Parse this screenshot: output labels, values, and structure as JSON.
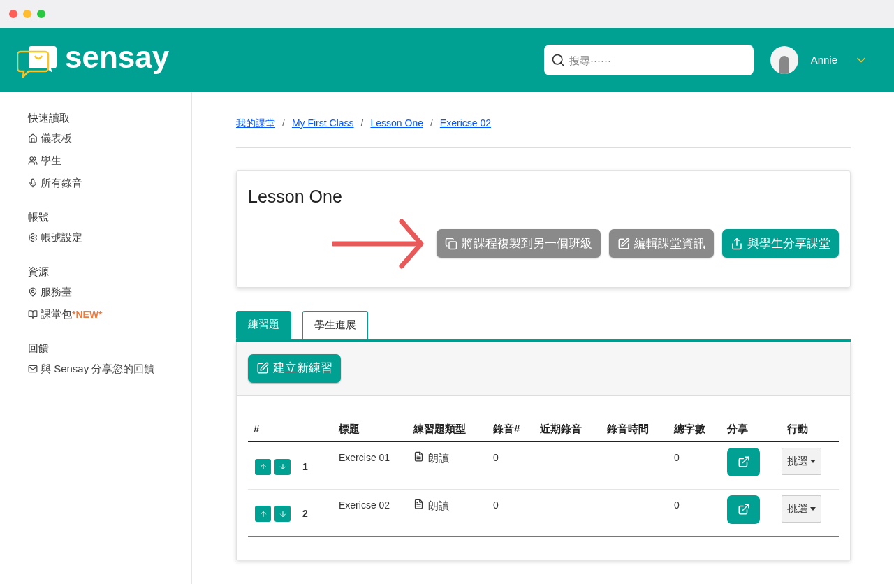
{
  "header": {
    "logo": "sensay",
    "search": {
      "placeholder": "搜尋⋯⋯"
    },
    "user": "Annie"
  },
  "sidebar": [
    {
      "title": "快速讀取",
      "items": [
        {
          "label": "儀表板"
        },
        {
          "label": "學生"
        },
        {
          "label": "所有錄音"
        }
      ]
    },
    {
      "title": "帳號",
      "items": [
        {
          "label": "帳號設定"
        }
      ]
    },
    {
      "title": "資源",
      "items": [
        {
          "label": "服務臺"
        },
        {
          "label": "課堂包",
          "badge": "*NEW*"
        }
      ]
    },
    {
      "title": "回饋",
      "items": [
        {
          "label": "與 Sensay 分享您的回饋"
        }
      ]
    }
  ],
  "breadcrumb": [
    {
      "kind": "link",
      "text": "我的課堂"
    },
    {
      "kind": "separator",
      "text": "/"
    },
    {
      "kind": "link",
      "text": "My First Class"
    },
    {
      "kind": "separator",
      "text": "/"
    },
    {
      "kind": "link",
      "text": "Lesson One"
    },
    {
      "kind": "separator",
      "text": "/"
    },
    {
      "kind": "link",
      "text": "Exericse 02"
    }
  ],
  "lesson": {
    "title": "Lesson One",
    "buttons": [
      {
        "kind": "gray",
        "label": "將課程複製到另一個班級"
      },
      {
        "kind": "gray",
        "label": "編輯課堂資訊"
      },
      {
        "kind": "teal",
        "label": "與學生分享課堂"
      }
    ]
  },
  "tabs": [
    {
      "label": "練習題",
      "selected": true
    },
    {
      "label": "學生進展",
      "selected": false
    }
  ],
  "new_button": "建立新練習",
  "table": {
    "columns": [
      "#",
      "標題",
      "練習題類型",
      "錄音#",
      "近期錄音",
      "錄音時間",
      "總字數",
      "分享",
      "行動"
    ],
    "rows": [
      {
        "number": "1",
        "title": "Exercise 01",
        "type": "朗讀",
        "recordings": "0",
        "words": "0",
        "action": "挑選"
      },
      {
        "number": "2",
        "title": "Exericse 02",
        "type": "朗讀",
        "recordings": "0",
        "words": "0",
        "action": "挑選"
      }
    ]
  }
}
